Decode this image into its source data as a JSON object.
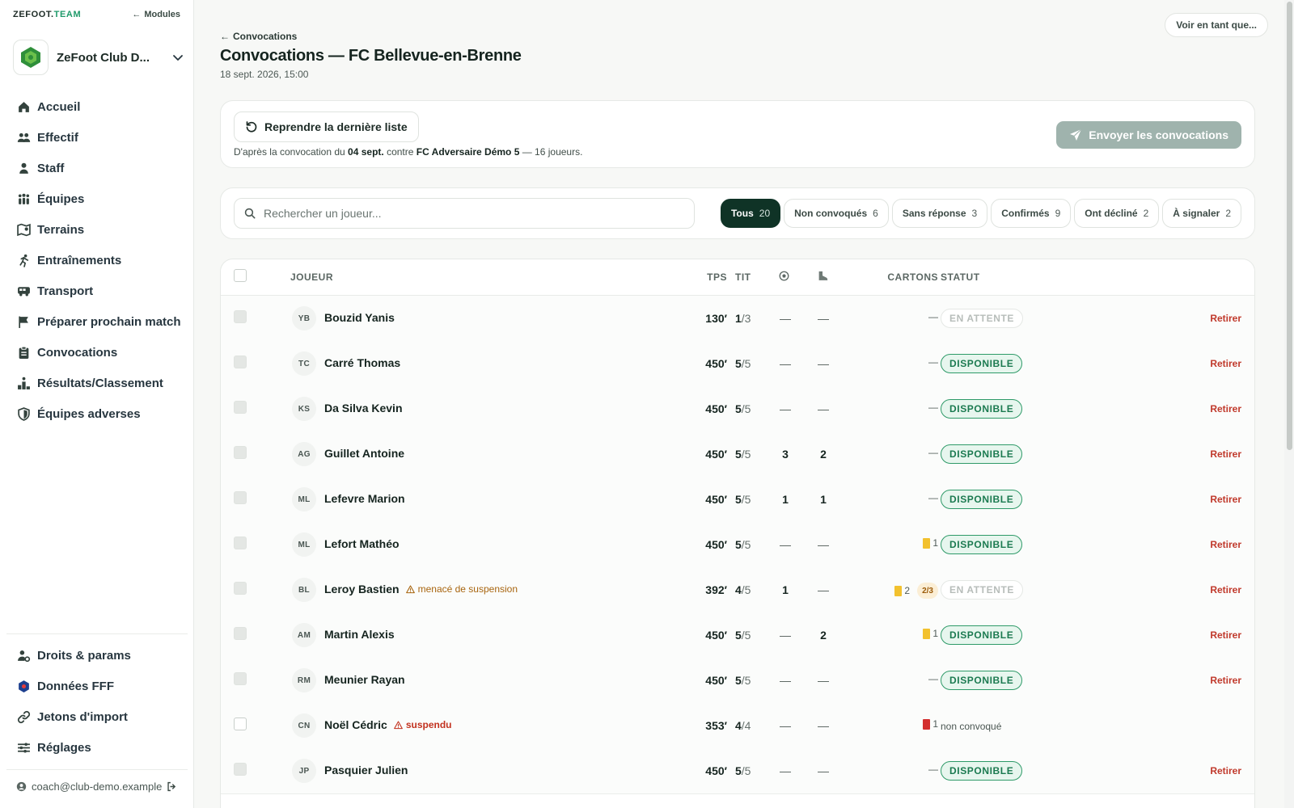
{
  "brand": {
    "prefix": "ZEFOOT.",
    "accent": "TEAM"
  },
  "modules_label": "Modules",
  "club": {
    "name": "ZeFoot Club D..."
  },
  "nav": [
    {
      "label": "Accueil",
      "icon": "home-icon"
    },
    {
      "label": "Effectif",
      "icon": "users-icon"
    },
    {
      "label": "Staff",
      "icon": "user-icon"
    },
    {
      "label": "Équipes",
      "icon": "teams-icon"
    },
    {
      "label": "Terrains",
      "icon": "map-icon"
    },
    {
      "label": "Entraînements",
      "icon": "run-icon"
    },
    {
      "label": "Transport",
      "icon": "bus-icon"
    },
    {
      "label": "Préparer prochain match",
      "icon": "flag-icon"
    },
    {
      "label": "Convocations",
      "icon": "clipboard-icon"
    },
    {
      "label": "Résultats/Classement",
      "icon": "podium-icon"
    },
    {
      "label": "Équipes adverses",
      "icon": "shield-icon"
    }
  ],
  "nav_bottom": [
    {
      "label": "Droits & params",
      "icon": "user-cog-icon"
    },
    {
      "label": "Données FFF",
      "icon": "fff-icon"
    },
    {
      "label": "Jetons d'import",
      "icon": "link-icon"
    },
    {
      "label": "Réglages",
      "icon": "sliders-icon"
    }
  ],
  "user_email": "coach@club-demo.example",
  "view_as_label": "Voir en tant que...",
  "back_label": "Convocations",
  "page_title": "Convocations — FC Bellevue-en-Brenne",
  "page_sub": "18 sept. 2026, 15:00",
  "resume": {
    "button": "Reprendre la dernière liste",
    "note_prefix": "D'après la convocation du ",
    "note_date": "04 sept.",
    "note_mid": " contre ",
    "note_team": "FC Adversaire Démo 5",
    "note_suffix": " — 16 joueurs."
  },
  "send_button": "Envoyer les convocations",
  "search_placeholder": "Rechercher un joueur...",
  "filters": [
    {
      "label": "Tous",
      "count": "20",
      "active": true
    },
    {
      "label": "Non convoqués",
      "count": "6"
    },
    {
      "label": "Sans réponse",
      "count": "3"
    },
    {
      "label": "Confirmés",
      "count": "9"
    },
    {
      "label": "Ont décliné",
      "count": "2"
    },
    {
      "label": "À signaler",
      "count": "2"
    }
  ],
  "table": {
    "headers": {
      "player": "JOUEUR",
      "tps": "TPS",
      "tit": "TIT",
      "cards": "CARTONS",
      "status": "STATUT"
    },
    "header_icons": {
      "goals": "ball-icon",
      "assists": "boot-icon"
    },
    "colors": {
      "yellow": "#f2c12e",
      "red": "#d32f2f",
      "dispo": "#2e9a68",
      "retirer": "#c0392b"
    },
    "rows": [
      {
        "initials": "YB",
        "name": "Bouzid Yanis",
        "tps": "130′",
        "tit": "1",
        "tit_total": "/3",
        "goals": "—",
        "assists": "—",
        "cards": "—",
        "status": "EN ATTENTE",
        "status_kind": "attente",
        "action": "Retirer",
        "checked": true
      },
      {
        "initials": "TC",
        "name": "Carré Thomas",
        "tps": "450′",
        "tit": "5",
        "tit_total": "/5",
        "goals": "—",
        "assists": "—",
        "cards": "—",
        "status": "DISPONIBLE",
        "status_kind": "dispo",
        "action": "Retirer",
        "checked": true
      },
      {
        "initials": "KS",
        "name": "Da Silva Kevin",
        "tps": "450′",
        "tit": "5",
        "tit_total": "/5",
        "goals": "—",
        "assists": "—",
        "cards": "—",
        "status": "DISPONIBLE",
        "status_kind": "dispo",
        "action": "Retirer",
        "checked": true
      },
      {
        "initials": "AG",
        "name": "Guillet Antoine",
        "tps": "450′",
        "tit": "5",
        "tit_total": "/5",
        "goals": "3",
        "assists": "2",
        "cards": "—",
        "status": "DISPONIBLE",
        "status_kind": "dispo",
        "action": "Retirer",
        "checked": true
      },
      {
        "initials": "ML",
        "name": "Lefevre Marion",
        "tps": "450′",
        "tit": "5",
        "tit_total": "/5",
        "goals": "1",
        "assists": "1",
        "cards": "—",
        "status": "DISPONIBLE",
        "status_kind": "dispo",
        "action": "Retirer",
        "checked": true
      },
      {
        "initials": "ML",
        "name": "Lefort Mathéo",
        "tps": "450′",
        "tit": "5",
        "tit_total": "/5",
        "goals": "—",
        "assists": "—",
        "yellow": "1",
        "status": "DISPONIBLE",
        "status_kind": "dispo",
        "action": "Retirer",
        "checked": true
      },
      {
        "initials": "BL",
        "name": "Leroy Bastien",
        "warn": "menacé de suspension",
        "tps": "392′",
        "tit": "4",
        "tit_total": "/5",
        "goals": "1",
        "assists": "—",
        "yellow": "2",
        "susp": "2/3",
        "status": "EN ATTENTE",
        "status_kind": "attente",
        "action": "Retirer",
        "checked": true
      },
      {
        "initials": "AM",
        "name": "Martin Alexis",
        "tps": "450′",
        "tit": "5",
        "tit_total": "/5",
        "goals": "—",
        "assists": "2",
        "yellow": "1",
        "status": "DISPONIBLE",
        "status_kind": "dispo",
        "action": "Retirer",
        "checked": true
      },
      {
        "initials": "RM",
        "name": "Meunier Rayan",
        "tps": "450′",
        "tit": "5",
        "tit_total": "/5",
        "goals": "—",
        "assists": "—",
        "cards": "—",
        "status": "DISPONIBLE",
        "status_kind": "dispo",
        "action": "Retirer",
        "checked": true
      },
      {
        "initials": "CN",
        "name": "Noël Cédric",
        "danger": "suspendu",
        "tps": "353′",
        "tit": "4",
        "tit_total": "/4",
        "goals": "—",
        "assists": "—",
        "red": "1",
        "status": "non convoqué",
        "status_kind": "nc",
        "checked": false
      },
      {
        "initials": "JP",
        "name": "Pasquier Julien",
        "tps": "450′",
        "tit": "5",
        "tit_total": "/5",
        "goals": "—",
        "assists": "—",
        "cards": "—",
        "status": "DISPONIBLE",
        "status_kind": "dispo",
        "action": "Retirer",
        "checked": true
      }
    ]
  }
}
